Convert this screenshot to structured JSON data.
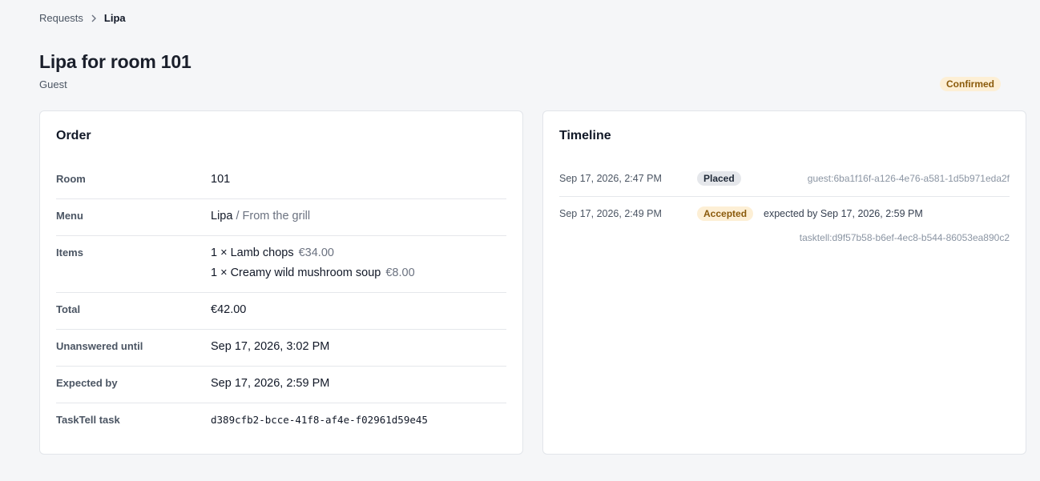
{
  "breadcrumb": {
    "parent": "Requests",
    "current": "Lipa",
    "separator_icon": "chevron-right-icon"
  },
  "header": {
    "title": "Lipa for room 101",
    "subtitle": "Guest",
    "status": "Confirmed"
  },
  "order": {
    "heading": "Order",
    "room_label": "Room",
    "room_value": "101",
    "menu_label": "Menu",
    "menu_name": "Lipa",
    "menu_section": " / From the grill",
    "items_label": "Items",
    "items": [
      {
        "text": "1 × Lamb chops",
        "price": "€34.00"
      },
      {
        "text": "1 × Creamy wild mushroom soup",
        "price": "€8.00"
      }
    ],
    "total_label": "Total",
    "total_value": "€42.00",
    "unanswered_label": "Unanswered until",
    "unanswered_value": "Sep 17, 2026, 3:02 PM",
    "expected_label": "Expected by",
    "expected_value": "Sep 17, 2026, 2:59 PM",
    "task_label": "TaskTell task",
    "task_value": "d389cfb2-bcce-41f8-af4e-f02961d59e45"
  },
  "timeline": {
    "heading": "Timeline",
    "events": [
      {
        "time": "Sep 17, 2026, 2:47 PM",
        "status": "Placed",
        "note": "",
        "actor": "guest:6ba1f16f-a126-4e76-a581-1d5b971eda2f"
      },
      {
        "time": "Sep 17, 2026, 2:49 PM",
        "status": "Accepted",
        "note": "expected by Sep 17, 2026, 2:59 PM",
        "actor": "tasktell:d9f57b58-b6ef-4ec8-b544-86053ea890c2"
      }
    ]
  },
  "colors": {
    "background": "#f5f6f8",
    "confirmed_badge_bg": "#fdefd5",
    "confirmed_badge_fg": "#8a5a0b",
    "placed_badge_bg": "#e5e7eb"
  }
}
